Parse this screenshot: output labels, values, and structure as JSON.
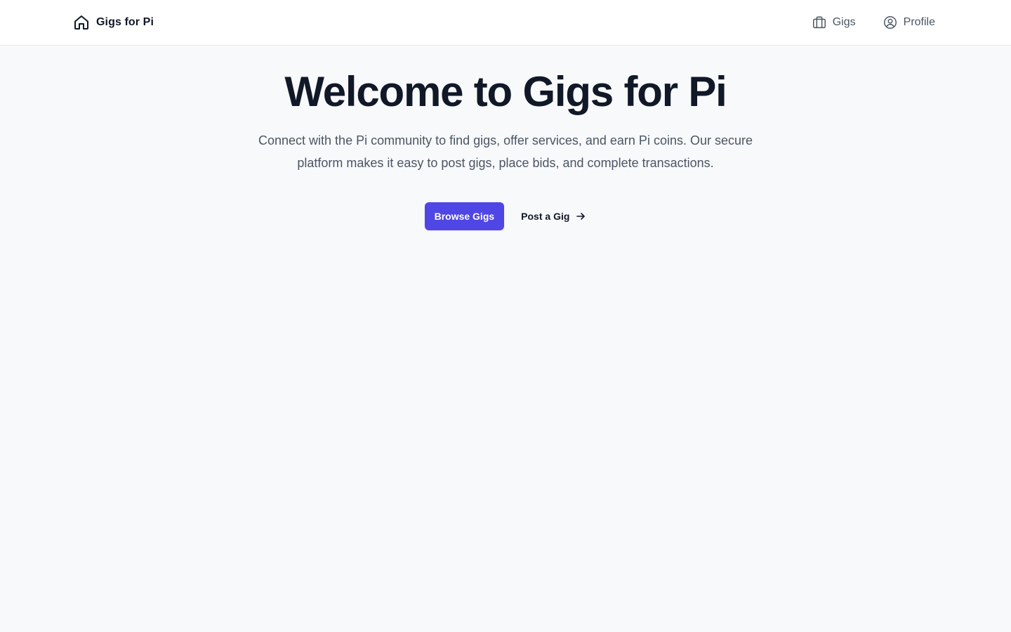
{
  "nav": {
    "brand": {
      "label": "Gigs for Pi",
      "icon": "home-icon"
    },
    "links": [
      {
        "label": "Gigs",
        "icon": "briefcase-icon"
      },
      {
        "label": "Profile",
        "icon": "user-circle-icon"
      }
    ]
  },
  "hero": {
    "title": "Welcome to Gigs for Pi",
    "subtitle": "Connect with the Pi community to find gigs, offer services, and earn Pi coins. Our secure platform makes it easy to post gigs, place bids, and complete transactions.",
    "primary_cta": "Browse Gigs",
    "secondary_cta": "Post a Gig",
    "secondary_cta_icon": "arrow-right-icon"
  },
  "colors": {
    "accent": "#4f46e5",
    "background": "#f8f9fb",
    "nav_background": "#ffffff",
    "text_primary": "#111827",
    "text_secondary": "#4b5563"
  }
}
